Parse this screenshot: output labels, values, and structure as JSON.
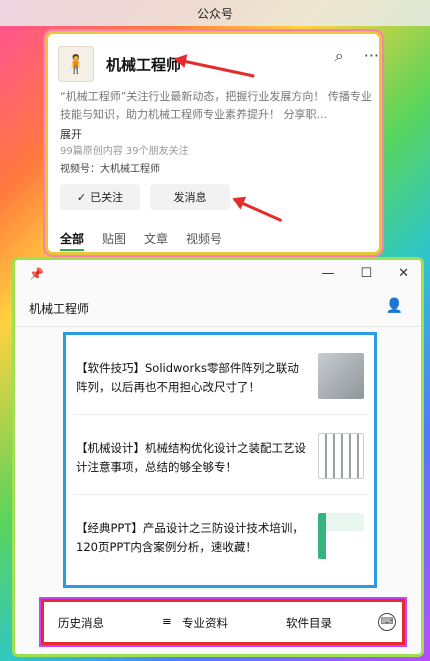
{
  "topbar": {
    "title": "公众号"
  },
  "account": {
    "name": "机械工程师",
    "intro": "“机械工程师”关注行业最新动态，把握行业发展方向！ 传播专业技能与知识，助力机械工程师专业素养提升！ 分享职...",
    "expand": "展开",
    "meta": "99篇原创内容  39个朋友关注",
    "video": "视频号：大机械工程师",
    "follow_label": "已关注",
    "message_label": "发消息",
    "tabs": [
      "全部",
      "贴图",
      "文章",
      "视频号"
    ]
  },
  "window": {
    "title": "机械工程师",
    "articles": [
      {
        "title": "【软件技巧】Solidworks零部件阵列之联动阵列，以后再也不用担心改尺寸了！"
      },
      {
        "title": "【机械设计】机械结构优化设计之装配工艺设计注意事项，总结的够全够专！"
      },
      {
        "title": "【经典PPT】产品设计之三防设计技术培训，120页PPT内含案例分析，速收藏！"
      }
    ],
    "menu": {
      "history": "历史消息",
      "materials": "专业资料",
      "catalog": "软件目录"
    }
  },
  "colors": {
    "accent_green": "#2bb24c",
    "arrow_red": "#e52b2b"
  }
}
